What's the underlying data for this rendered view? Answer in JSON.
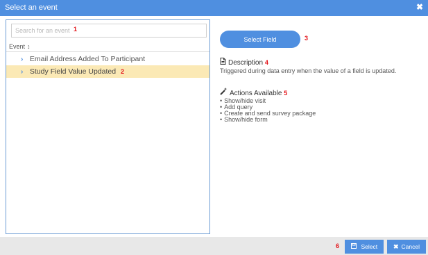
{
  "dialog": {
    "title": "Select an event",
    "close_glyph": "✖"
  },
  "search": {
    "placeholder": "Search for an event",
    "value": ""
  },
  "list": {
    "column_header": "Event",
    "sort_glyph": "↕",
    "items": [
      {
        "label": "Email Address Added To Participant",
        "selected": false
      },
      {
        "label": "Study Field Value Updated",
        "selected": true
      }
    ]
  },
  "details": {
    "select_field_label": "Select Field",
    "description_heading": "Description",
    "description_text": "Triggered during data entry when the value of a field is updated.",
    "actions_heading": "Actions Available",
    "actions": [
      "Show/hide visit",
      "Add query",
      "Create and send survey package",
      "Show/hide form"
    ]
  },
  "footer": {
    "select_label": "Select",
    "cancel_label": "Cancel"
  },
  "annotations": {
    "a1": "1",
    "a2": "2",
    "a3": "3",
    "a4": "4",
    "a5": "5",
    "a6": "6"
  },
  "icons": {
    "document": "document-icon",
    "wand": "magic-wand-icon",
    "save": "save-icon",
    "close": "close-icon",
    "chevron": "chevron-right-icon"
  },
  "colors": {
    "accent": "#4f8fe0",
    "selected_row": "#fbe9b5",
    "annotation": "#e3141a"
  }
}
